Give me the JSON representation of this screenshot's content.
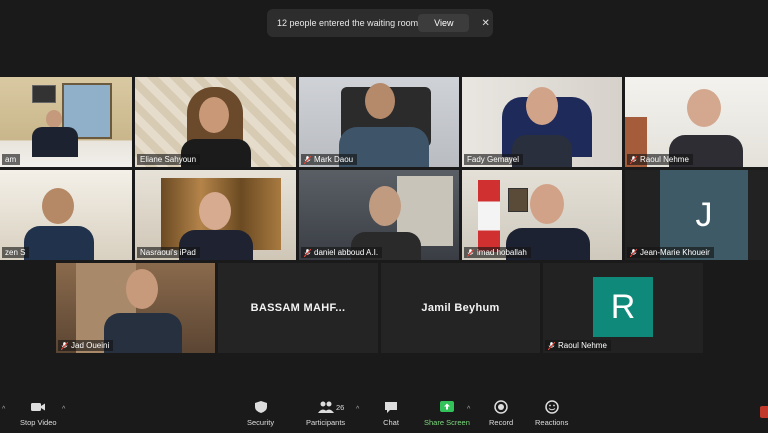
{
  "notification": {
    "message": "12 people entered the waiting room",
    "view_label": "View",
    "close_glyph": "✕"
  },
  "participants": [
    {
      "name": "am",
      "muted": false
    },
    {
      "name": "Eliane Sahyoun",
      "muted": false
    },
    {
      "name": "Mark Daou",
      "muted": true
    },
    {
      "name": "Fady Gemayel",
      "muted": false
    },
    {
      "name": "Raoul Nehme",
      "muted": true
    },
    {
      "name": "zen S",
      "muted": false
    },
    {
      "name": "Nasraoui's iPad",
      "muted": false
    },
    {
      "name": "daniel abboud A.I.",
      "muted": true
    },
    {
      "name": "imad hoballah",
      "muted": true
    },
    {
      "name": "Jean-Marie Khoueir",
      "muted": true
    },
    {
      "name": "Jad Oueini",
      "muted": true
    },
    {
      "name": "BASSAM  MAHF...",
      "muted": false
    },
    {
      "name": "Jamil Beyhum",
      "muted": false
    },
    {
      "name": "Raoul Nehme",
      "muted": true
    }
  ],
  "avatars": {
    "j": {
      "letter": "J",
      "color": "#3d5a66"
    },
    "r": {
      "letter": "R",
      "color": "#0f8a7a"
    }
  },
  "toolbar": {
    "stop_video": "Stop Video",
    "security": "Security",
    "participants": "Participants",
    "participants_count": "26",
    "chat": "Chat",
    "share_screen": "Share Screen",
    "record": "Record",
    "reactions": "Reactions",
    "caret": "^"
  },
  "colors": {
    "active_speaker": "#d9d85a",
    "share_green": "#33c15a",
    "mute_red": "#e0453a"
  }
}
